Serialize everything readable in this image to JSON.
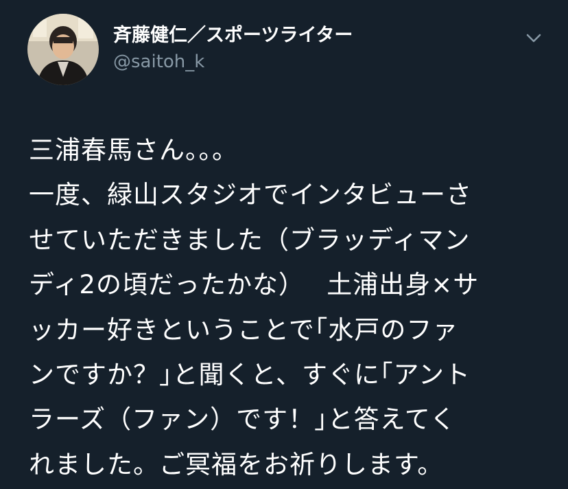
{
  "author": {
    "display_name": "斉藤健仁／スポーツライター",
    "handle": "@saitoh_k",
    "avatar_icon": "user-avatar"
  },
  "menu": {
    "icon": "chevron-down-icon"
  },
  "tweet": {
    "lines": [
      "三浦春馬さん。。。",
      "一度、緑山スタジオでインタビューさ",
      "せていただきました（ブラッディマン",
      "ディ2の頃だったかな）　 土浦出身×サ",
      "ッカー好きということで｢水戸のファ",
      "ンですか？｣と聞くと、すぐに｢アント",
      "ラーズ（ファン）です！｣と答えてく",
      "れました。ご冥福をお祈りします。"
    ]
  },
  "colors": {
    "background": "#15202b",
    "text": "#ffffff",
    "secondary_text": "#8899a6"
  }
}
